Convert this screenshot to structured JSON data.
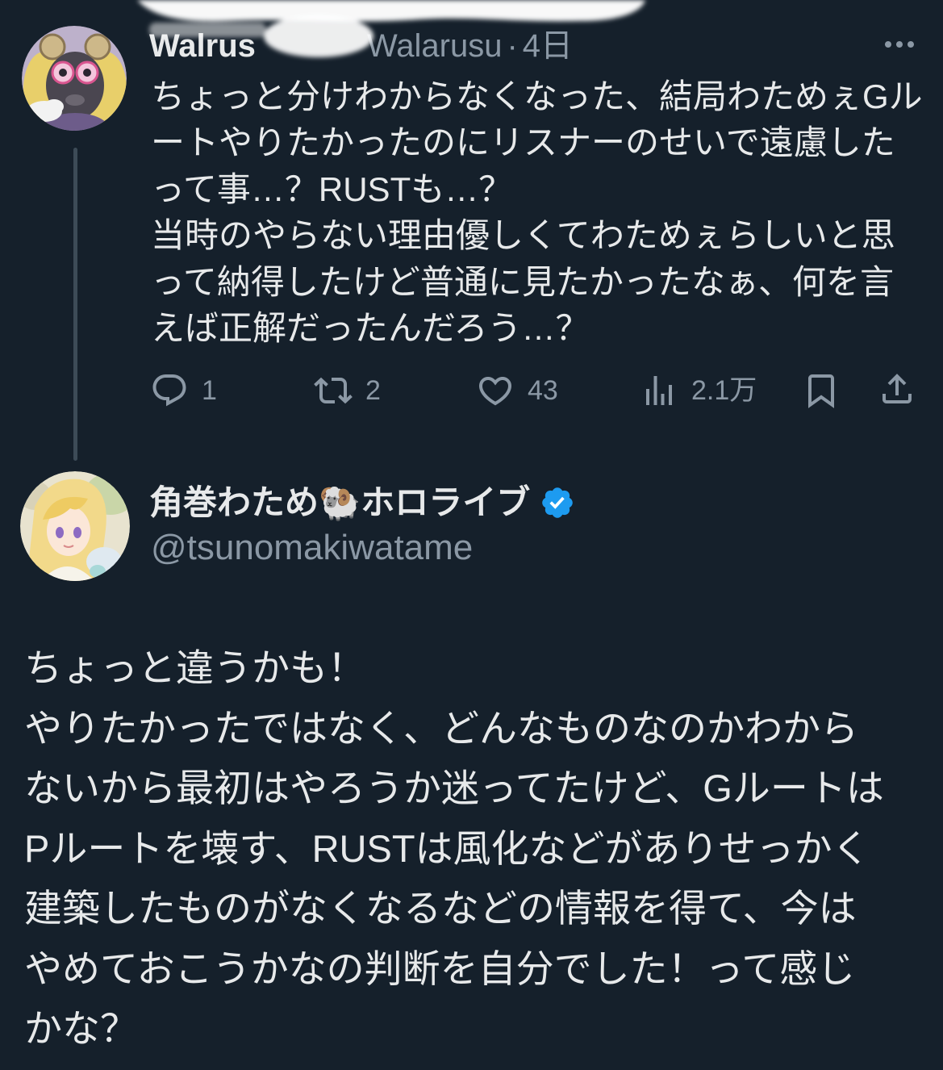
{
  "theme": {
    "background": "#15202b",
    "text": "#e7e9ea",
    "muted": "#8b98a5",
    "thread_line": "#3d4b57",
    "verified": "#1d9bf0",
    "redaction": "#ffffff"
  },
  "parent_tweet": {
    "author_name": "Walrus",
    "handle": "Walarusu",
    "separator": "·",
    "time": "4日",
    "more_icon": "more-horizontal-icon",
    "text_lines": [
      "ちょっと分けわからなくなった、結局わためぇGル",
      "ートやりたかったのにリスナーのせいで遠慮した",
      "って事…？RUSTも…？",
      "当時のやらない理由優しくてわためぇらしいと思",
      "って納得したけど普通に見たかったなぁ、何を言",
      "えば正解だったんだろう…？"
    ],
    "actions": {
      "reply": {
        "icon": "reply-icon",
        "count": "1"
      },
      "repost": {
        "icon": "repost-icon",
        "count": "2"
      },
      "like": {
        "icon": "heart-icon",
        "count": "43"
      },
      "views": {
        "icon": "views-chart-icon",
        "count": "2.1万"
      },
      "bookmark": {
        "icon": "bookmark-icon"
      },
      "share": {
        "icon": "share-icon"
      }
    }
  },
  "main_tweet": {
    "author_name": "角巻わため🐏ホロライブ",
    "verified_icon": "verified-badge-icon",
    "handle": "@tsunomakiwatame",
    "text_lines": [
      "ちょっと違うかも！",
      "やりたかったではなく、どんなものなのかわから",
      "ないから最初はやろうか迷ってたけど、Gルートは",
      "Pルートを壊す、RUSTは風化などがありせっかく",
      "建築したものがなくなるなどの情報を得て、今は",
      "やめておこうかなの判断を自分でした！って感じ",
      "かな？"
    ]
  }
}
